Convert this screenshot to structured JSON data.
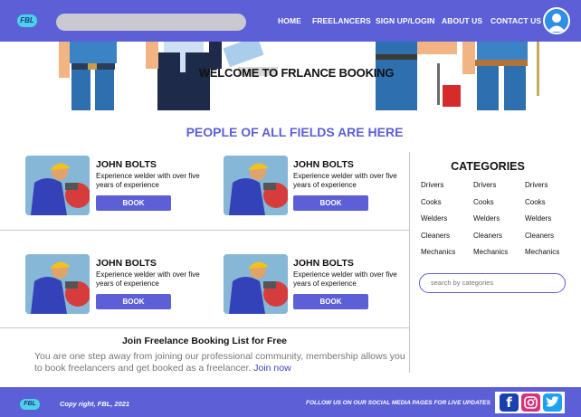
{
  "header": {
    "logo_text": "FBL",
    "search_placeholder": "",
    "nav": [
      "HOME",
      "FREELANCERS",
      "SIGN UP/LOGIN",
      "ABOUT US",
      "CONTACT US"
    ]
  },
  "hero": {
    "title": "WELCOME TO FRLANCE BOOKING"
  },
  "section_title": "PEOPLE OF ALL FIELDS ARE HERE",
  "freelancers": [
    {
      "name": "JOHN BOLTS",
      "desc": "Experience welder with over five years of experience",
      "button": "BOOK"
    },
    {
      "name": "JOHN BOLTS",
      "desc": "Experience welder with over five years of experience",
      "button": "BOOK"
    },
    {
      "name": "JOHN BOLTS",
      "desc": "Experience welder with over five years of experience",
      "button": "BOOK"
    },
    {
      "name": "JOHN BOLTS",
      "desc": "Experience welder with over five years of experience",
      "button": "BOOK"
    }
  ],
  "categories": {
    "title": "CATEGORIES",
    "columns": [
      [
        "Drivers",
        "Cooks",
        "Welders",
        "Cleaners",
        "Mechanics"
      ],
      [
        "Drivers",
        "Cooks",
        "Welders",
        "Cleaners",
        "Mechanics"
      ],
      [
        "Drivers",
        "Cooks",
        "Welders",
        "Cleaners",
        "Mechanics"
      ]
    ],
    "search_placeholder": "search by categories"
  },
  "join": {
    "title": "Join Freelance Booking List for Free",
    "text": "You are one step away from joining our professional community, membership allows you to book freelancers and get booked as a freelancer.",
    "link": "Join now"
  },
  "footer": {
    "logo_text": "FBL",
    "copyright": "Copy right, FBL, 2021",
    "follow": "FOLLOW US ON OUR SOCIAL MEDIA PAGES FOR LIVE UPDATES",
    "social": [
      "facebook-icon",
      "instagram-icon",
      "twitter-icon"
    ]
  },
  "colors": {
    "brand": "#5c5fd6",
    "accent": "#49d3e6"
  }
}
